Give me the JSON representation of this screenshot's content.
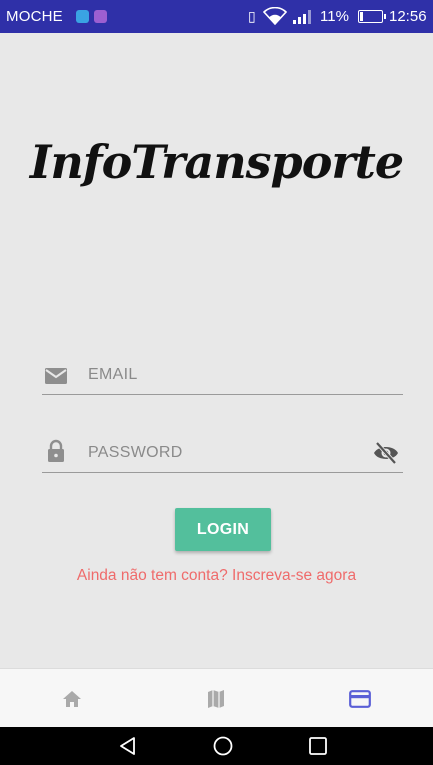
{
  "status_bar": {
    "carrier": "MOCHE",
    "battery_percent": "11%",
    "time": "12:56"
  },
  "app": {
    "title": "InfoTransporte"
  },
  "form": {
    "email_placeholder": "EMAIL",
    "password_placeholder": "PASSWORD",
    "login_label": "LOGIN",
    "signup_text": "Ainda não tem conta? Inscreva-se agora"
  },
  "bottom_nav": {
    "items": [
      {
        "icon": "home-icon",
        "active": false
      },
      {
        "icon": "map-icon",
        "active": false
      },
      {
        "icon": "card-icon",
        "active": true
      }
    ]
  },
  "colors": {
    "status_bar": "#2f30a8",
    "accent": "#53bf9c",
    "link": "#ef6b6b",
    "active_nav": "#5a5fd6",
    "inactive_nav": "#aaaaaa"
  }
}
